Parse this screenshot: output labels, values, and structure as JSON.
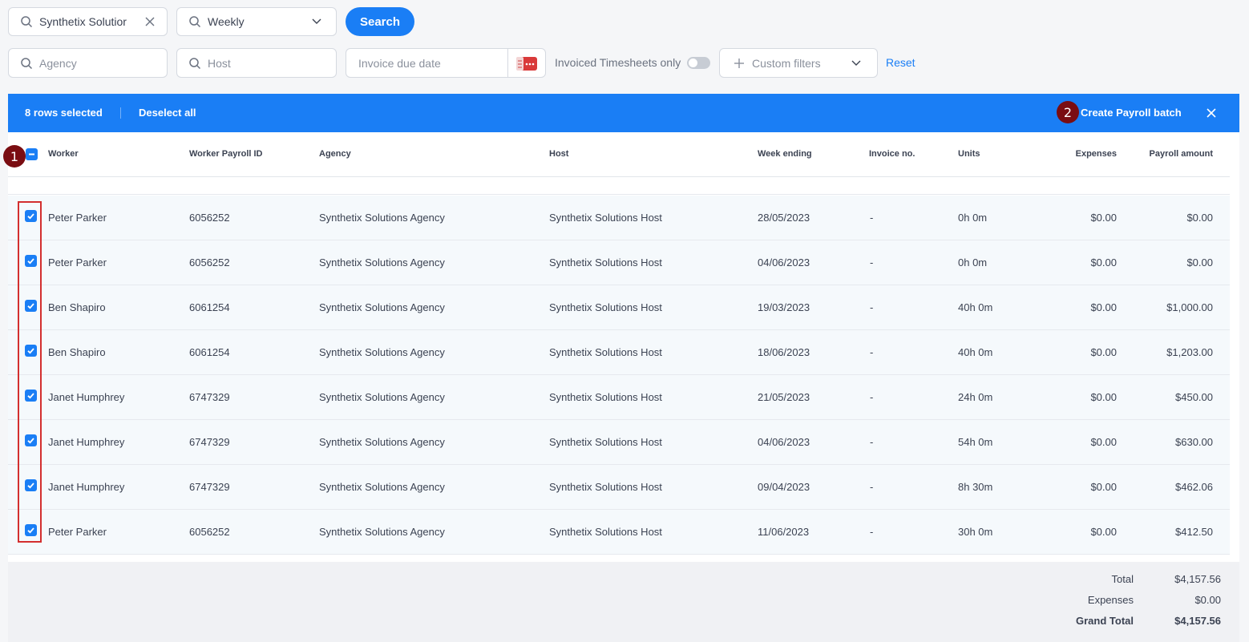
{
  "filters": {
    "search_value": "Synthetix Solutior",
    "period_value": "Weekly",
    "search_button": "Search",
    "agency_placeholder": "Agency",
    "host_placeholder": "Host",
    "invoice_due_placeholder": "Invoice due date",
    "invoiced_only_label": "Invoiced Timesheets only",
    "invoiced_only_on": false,
    "custom_filters_label": "Custom filters",
    "reset_label": "Reset"
  },
  "selection_bar": {
    "selected_text": "8 rows selected",
    "deselect_label": "Deselect all",
    "create_label": "Create Payroll batch"
  },
  "markers": {
    "one": "1",
    "two": "2"
  },
  "table": {
    "headers": {
      "worker": "Worker",
      "payroll_id": "Worker Payroll ID",
      "agency": "Agency",
      "host": "Host",
      "week_ending": "Week ending",
      "invoice_no": "Invoice no.",
      "units": "Units",
      "expenses": "Expenses",
      "payroll_amount": "Payroll amount"
    },
    "rows": [
      {
        "worker": "Peter Parker",
        "payroll_id": "6056252",
        "agency": "Synthetix Solutions Agency",
        "host": "Synthetix Solutions Host",
        "week_ending": "28/05/2023",
        "invoice_no": "-",
        "units": "0h 0m",
        "expenses": "$0.00",
        "payroll_amount": "$0.00"
      },
      {
        "worker": "Peter Parker",
        "payroll_id": "6056252",
        "agency": "Synthetix Solutions Agency",
        "host": "Synthetix Solutions Host",
        "week_ending": "04/06/2023",
        "invoice_no": "-",
        "units": "0h 0m",
        "expenses": "$0.00",
        "payroll_amount": "$0.00"
      },
      {
        "worker": "Ben Shapiro",
        "payroll_id": "6061254",
        "agency": "Synthetix Solutions Agency",
        "host": "Synthetix Solutions Host",
        "week_ending": "19/03/2023",
        "invoice_no": "-",
        "units": "40h 0m",
        "expenses": "$0.00",
        "payroll_amount": "$1,000.00"
      },
      {
        "worker": "Ben Shapiro",
        "payroll_id": "6061254",
        "agency": "Synthetix Solutions Agency",
        "host": "Synthetix Solutions Host",
        "week_ending": "18/06/2023",
        "invoice_no": "-",
        "units": "40h 0m",
        "expenses": "$0.00",
        "payroll_amount": "$1,203.00"
      },
      {
        "worker": "Janet Humphrey",
        "payroll_id": "6747329",
        "agency": "Synthetix Solutions Agency",
        "host": "Synthetix Solutions Host",
        "week_ending": "21/05/2023",
        "invoice_no": "-",
        "units": "24h 0m",
        "expenses": "$0.00",
        "payroll_amount": "$450.00"
      },
      {
        "worker": "Janet Humphrey",
        "payroll_id": "6747329",
        "agency": "Synthetix Solutions Agency",
        "host": "Synthetix Solutions Host",
        "week_ending": "04/06/2023",
        "invoice_no": "-",
        "units": "54h 0m",
        "expenses": "$0.00",
        "payroll_amount": "$630.00"
      },
      {
        "worker": "Janet Humphrey",
        "payroll_id": "6747329",
        "agency": "Synthetix Solutions Agency",
        "host": "Synthetix Solutions Host",
        "week_ending": "09/04/2023",
        "invoice_no": "-",
        "units": "8h 30m",
        "expenses": "$0.00",
        "payroll_amount": "$462.06"
      },
      {
        "worker": "Peter Parker",
        "payroll_id": "6056252",
        "agency": "Synthetix Solutions Agency",
        "host": "Synthetix Solutions Host",
        "week_ending": "11/06/2023",
        "invoice_no": "-",
        "units": "30h 0m",
        "expenses": "$0.00",
        "payroll_amount": "$412.50"
      }
    ]
  },
  "totals": {
    "total_label": "Total",
    "total_value": "$4,157.56",
    "expenses_label": "Expenses",
    "expenses_value": "$0.00",
    "grand_total_label": "Grand Total",
    "grand_total_value": "$4,157.56"
  },
  "colors": {
    "accent": "#1a7ef5",
    "marker": "#7a0d12",
    "highlight": "#d32f2f"
  }
}
